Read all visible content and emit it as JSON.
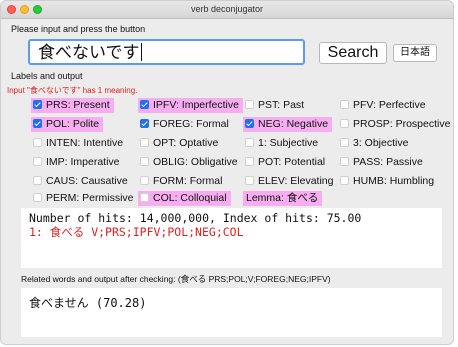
{
  "window": {
    "title": "verb deconjugator"
  },
  "prompt": "Please input and press the button",
  "input": {
    "value": "食べないです"
  },
  "buttons": {
    "search": "Search",
    "language": "日本語"
  },
  "labels_title": "Labels and output",
  "meaning_text": "Input \"食べないです\" has 1 meaning.",
  "tags": [
    {
      "label": "PRS: Present",
      "checked": true,
      "highlighted": true
    },
    {
      "label": "IPFV: Imperfective",
      "checked": true,
      "highlighted": true
    },
    {
      "label": "PST: Past",
      "checked": false,
      "highlighted": false
    },
    {
      "label": "PFV: Perfective",
      "checked": false,
      "highlighted": false
    },
    {
      "label": "POL: Polite",
      "checked": true,
      "highlighted": true
    },
    {
      "label": "FOREG: Formal",
      "checked": true,
      "highlighted": false
    },
    {
      "label": "NEG: Negative",
      "checked": true,
      "highlighted": true
    },
    {
      "label": "PROSP: Prospective",
      "checked": false,
      "highlighted": false
    },
    {
      "label": "INTEN: Intentive",
      "checked": false,
      "highlighted": false
    },
    {
      "label": "OPT: Optative",
      "checked": false,
      "highlighted": false
    },
    {
      "label": "1: Subjective",
      "checked": false,
      "highlighted": false
    },
    {
      "label": "3: Objective",
      "checked": false,
      "highlighted": false
    },
    {
      "label": "IMP: Imperative",
      "checked": false,
      "highlighted": false
    },
    {
      "label": "OBLIG: Obligative",
      "checked": false,
      "highlighted": false
    },
    {
      "label": "POT: Potential",
      "checked": false,
      "highlighted": false
    },
    {
      "label": "PASS: Passive",
      "checked": false,
      "highlighted": false
    },
    {
      "label": "CAUS: Causative",
      "checked": false,
      "highlighted": false
    },
    {
      "label": "FORM: Formal",
      "checked": false,
      "highlighted": false
    },
    {
      "label": "ELEV: Elevating",
      "checked": false,
      "highlighted": false
    },
    {
      "label": "HUMB: Humbling",
      "checked": false,
      "highlighted": false
    },
    {
      "label": "PERM: Permissive",
      "checked": false,
      "highlighted": false
    },
    {
      "label": "COL: Colloquial",
      "checked": false,
      "highlighted": true
    },
    {
      "label": "Lemma: 食べる",
      "checked": null,
      "highlighted": true
    }
  ],
  "output": {
    "line1": "Number of hits: 14,000,000, Index of hits: 75.00",
    "line2": "1: 食べる V;PRS;IPFV;POL;NEG;COL"
  },
  "related_title": "Related words and output after checking: (食べる PRS;POL;V;FOREG;NEG;IPFV)",
  "related_text": "食べません (70.28)",
  "colors": {
    "highlight": "#f7aef0",
    "accent": "#1f6ff0",
    "error": "#e02020"
  }
}
